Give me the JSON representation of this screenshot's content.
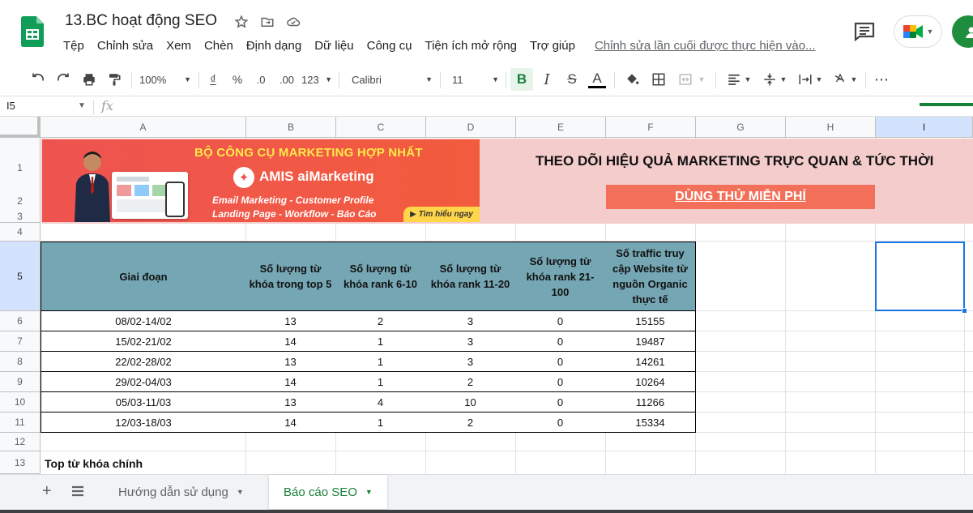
{
  "app": {
    "title": "13.BC hoạt động SEO",
    "menu": [
      "Tệp",
      "Chỉnh sửa",
      "Xem",
      "Chèn",
      "Định dạng",
      "Dữ liệu",
      "Công cụ",
      "Tiện ích mở rộng",
      "Trợ giúp"
    ],
    "last_edit": "Chỉnh sửa lần cuối được thực hiện vào...",
    "icons": [
      "star-icon",
      "move-to-folder-icon",
      "cloud-status-icon",
      "comment-icon",
      "google-meet-icon",
      "share-icon"
    ]
  },
  "toolbar": {
    "zoom": "100%",
    "currency": "₫",
    "percent": "%",
    "dec_decrease": ".0",
    "dec_increase": ".00",
    "format_more": "123",
    "font": "Calibri",
    "font_size": "11",
    "bold": "B",
    "italic": "I",
    "strike": "S",
    "text_color": "A",
    "more": "⋯"
  },
  "formula_bar": {
    "cell_ref": "I5",
    "fx": "fx",
    "value": ""
  },
  "columns": [
    "A",
    "B",
    "C",
    "D",
    "E",
    "F",
    "G",
    "H",
    "I"
  ],
  "selected_column": "I",
  "rows": [
    "1",
    "2",
    "3",
    "4",
    "5",
    "6",
    "7",
    "8",
    "9",
    "10",
    "11",
    "12",
    "13"
  ],
  "banner": {
    "promo_title": "BỘ CÔNG CỤ MARKETING HỢP NHẤT",
    "promo_brand": "AMIS aiMarketing",
    "promo_line1": "Email Marketing - Customer Profile",
    "promo_line2": "Landing Page - Workflow - Báo Cáo",
    "promo_cta": "▶ Tìm hiểu ngay",
    "headline": "THEO DÕI HIỆU QUẢ MARKETING TRỰC QUAN & TỨC THỜI",
    "try_button": "DÙNG THỬ MIỄN PHÍ"
  },
  "table": {
    "headers": [
      "Giai đoạn",
      "Số lượng từ khóa trong top 5",
      "Số lượng từ khóa rank 6-10",
      "Số lượng từ khóa rank 11-20",
      "Số lượng từ khóa rank 21-100",
      "Số traffic truy cập Website từ nguồn Organic thực tế"
    ],
    "rows": [
      [
        "08/02-14/02",
        "13",
        "2",
        "3",
        "0",
        "15155"
      ],
      [
        "15/02-21/02",
        "14",
        "1",
        "3",
        "0",
        "19487"
      ],
      [
        "22/02-28/02",
        "13",
        "1",
        "3",
        "0",
        "14261"
      ],
      [
        "29/02-04/03",
        "14",
        "1",
        "2",
        "0",
        "10264"
      ],
      [
        "05/03-11/03",
        "13",
        "4",
        "10",
        "0",
        "11266"
      ],
      [
        "12/03-18/03",
        "14",
        "1",
        "2",
        "0",
        "15334"
      ]
    ]
  },
  "row13_text": "Top từ khóa chính",
  "sheet_tabs": [
    {
      "label": "Hướng dẫn sử dụng",
      "active": false
    },
    {
      "label": "Báo cáo SEO",
      "active": true
    }
  ]
}
